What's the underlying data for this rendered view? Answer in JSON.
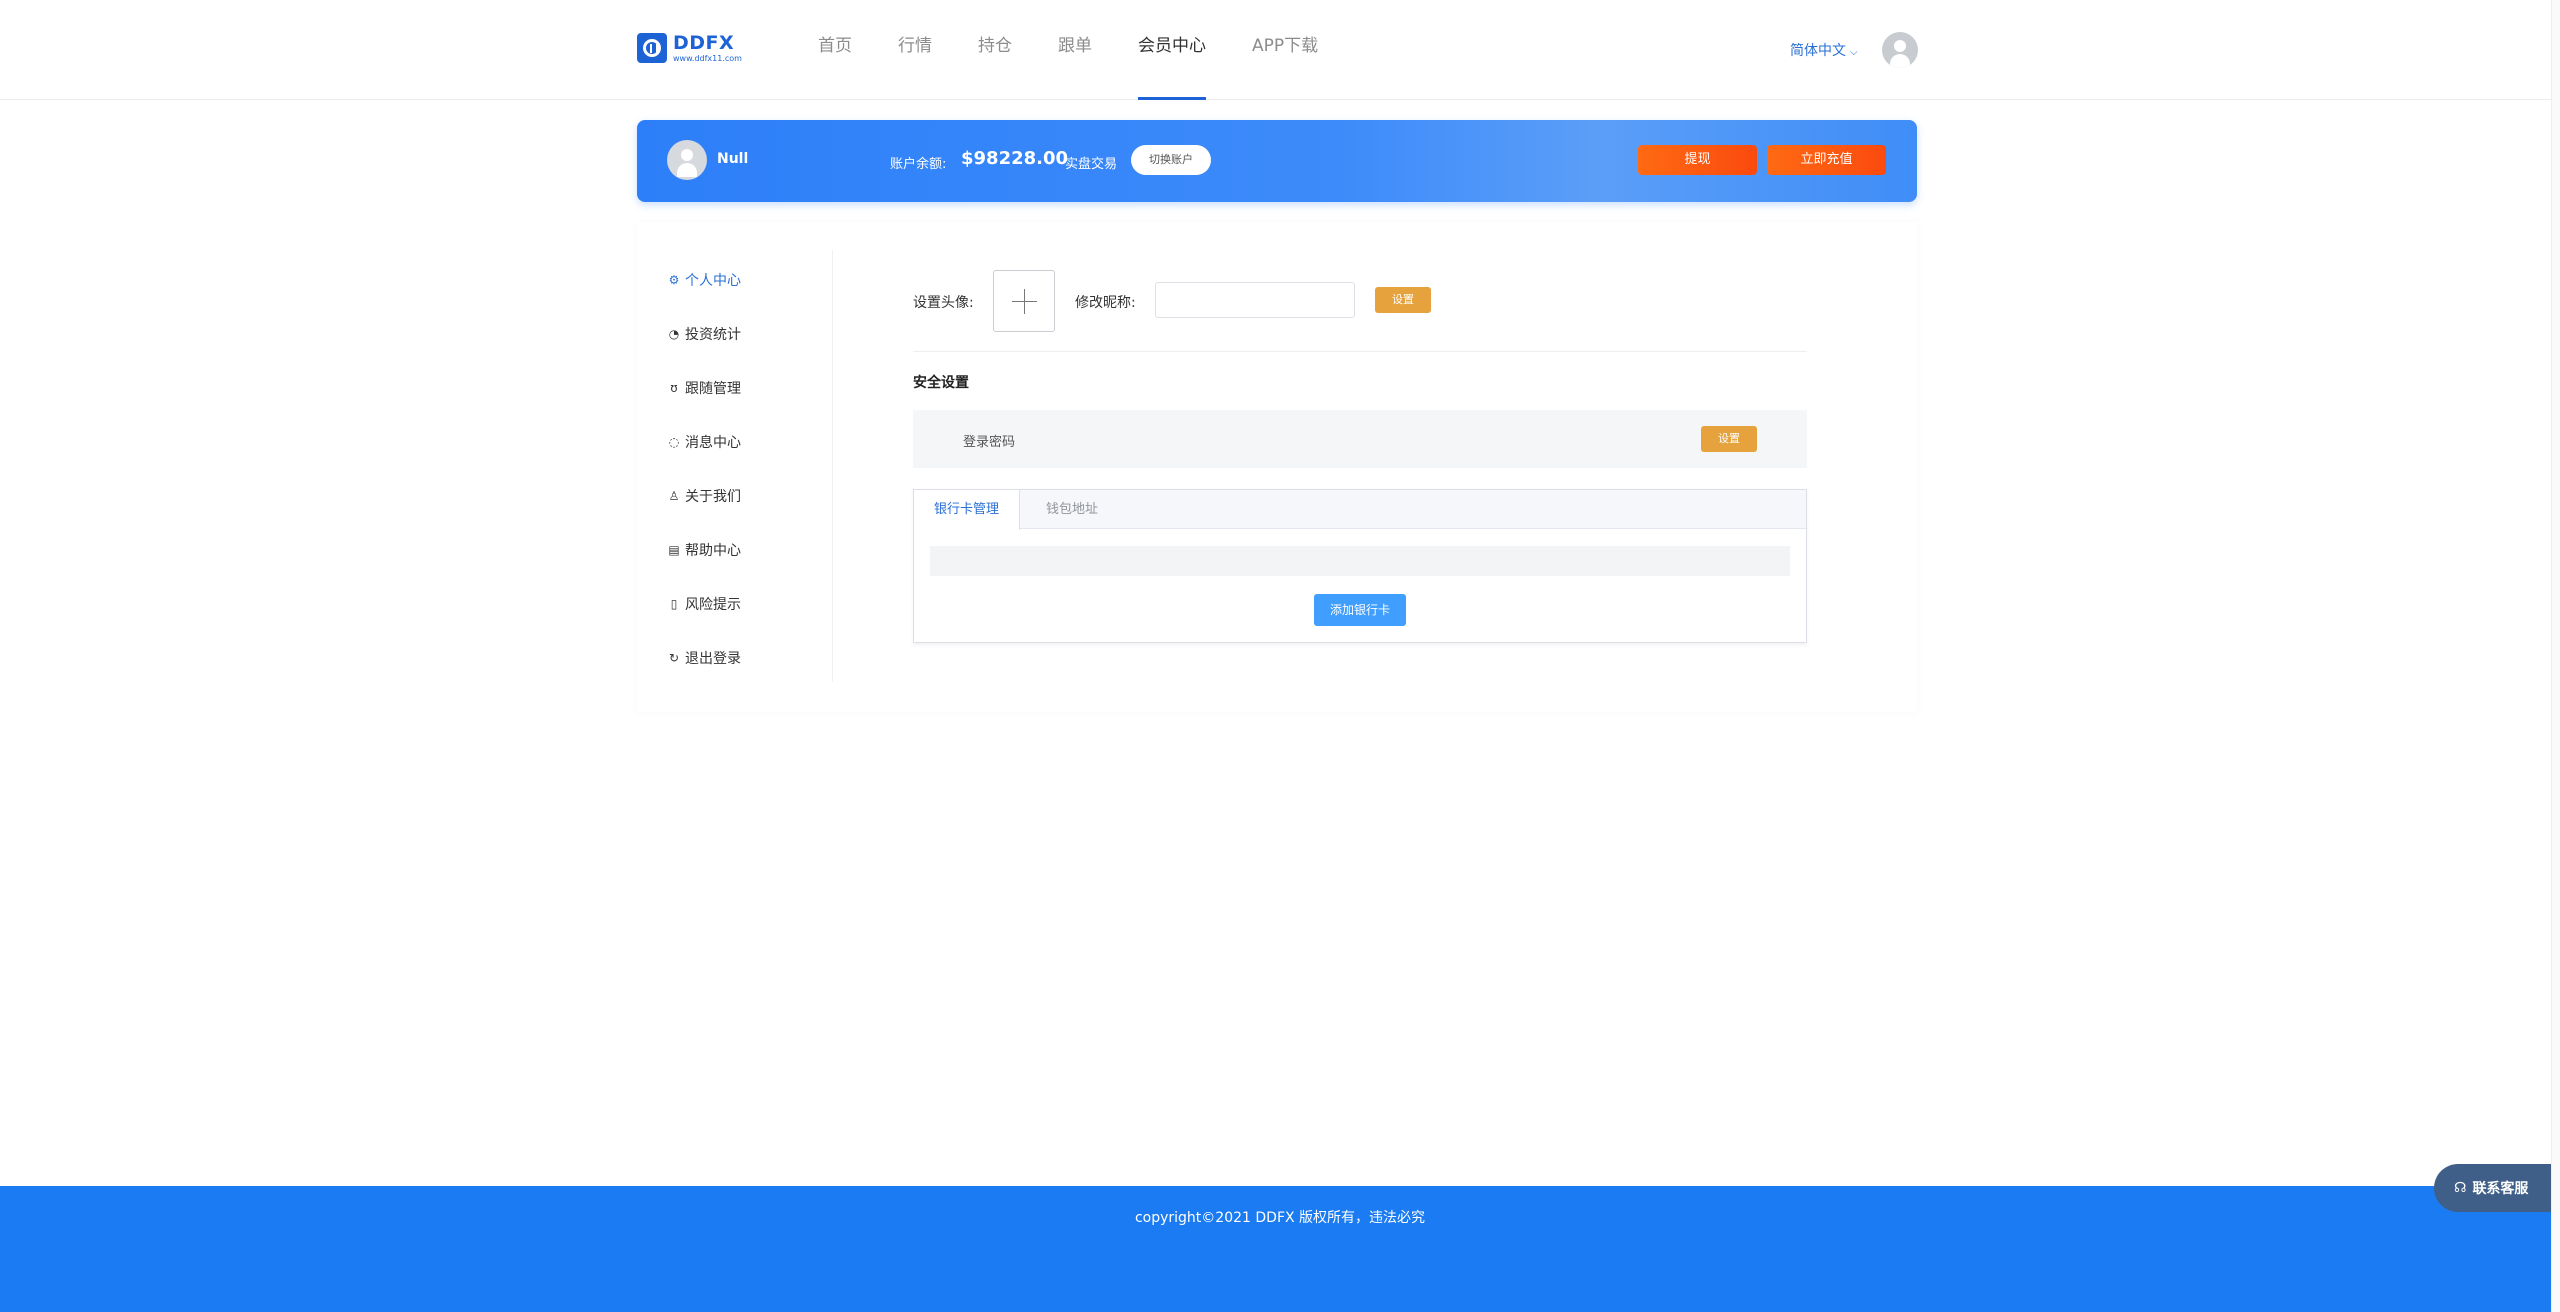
{
  "brand": {
    "name": "DDFX",
    "url": "www.ddfx11.com",
    "color": "#1e63d6"
  },
  "nav": {
    "items": [
      {
        "label": "首页"
      },
      {
        "label": "行情"
      },
      {
        "label": "持仓"
      },
      {
        "label": "跟单"
      },
      {
        "label": "会员中心",
        "active": true
      },
      {
        "label": "APP下载"
      }
    ],
    "language": "简体中文",
    "language_icon": "chevron-down-icon",
    "avatar_icon": "user-avatar-icon"
  },
  "banner": {
    "username": "Null",
    "balance_label": "账户余额:",
    "balance": "$98228.00",
    "mode": "实盘交易",
    "switch_label": "切换账户",
    "withdraw_label": "提现",
    "recharge_label": "立即充值",
    "gradient_start": "#2d7ff9",
    "button_color": "#ff6a13"
  },
  "sidebar": {
    "items": [
      {
        "label": "个人中心",
        "icon": "settings-icon",
        "active": true
      },
      {
        "label": "投资统计",
        "icon": "pie-chart-icon"
      },
      {
        "label": "跟随管理",
        "icon": "follow-icon"
      },
      {
        "label": "消息中心",
        "icon": "chat-icon"
      },
      {
        "label": "关于我们",
        "icon": "user-icon"
      },
      {
        "label": "帮助中心",
        "icon": "document-icon"
      },
      {
        "label": "风险提示",
        "icon": "bookmark-icon"
      },
      {
        "label": "退出登录",
        "icon": "refresh-icon"
      }
    ]
  },
  "profile": {
    "avatar_label": "设置头像:",
    "nickname_label": "修改昵称:",
    "nickname_value": "",
    "set_label": "设置",
    "security_title": "安全设置",
    "password_label": "登录密码",
    "password_set_label": "设置",
    "accent": "#e6a23c"
  },
  "tabs": {
    "items": [
      {
        "label": "银行卡管理",
        "active": true
      },
      {
        "label": "钱包地址"
      }
    ],
    "add_card_label": "添加银行卡"
  },
  "footer": {
    "copyright": "copyright©2021 DDFX 版权所有，违法必究",
    "color": "#1b7bf2"
  },
  "support": {
    "label": "联系客服",
    "icon": "headset-icon"
  }
}
